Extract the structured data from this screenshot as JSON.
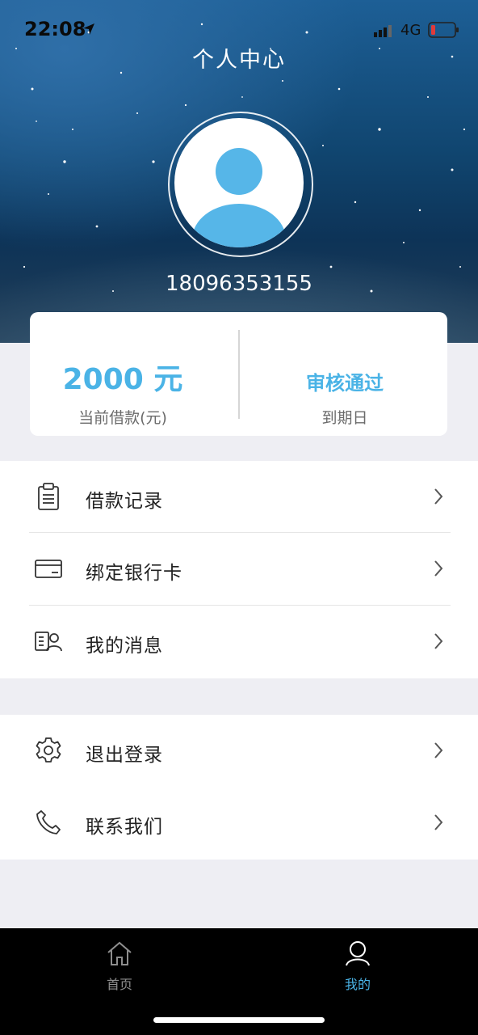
{
  "status_bar": {
    "time": "22:08",
    "network": "4G"
  },
  "header": {
    "title": "个人中心",
    "phone": "18096353155"
  },
  "summary": {
    "amount": "2000 元",
    "amount_label": "当前借款(元)",
    "status": "审核通过",
    "status_label": "到期日"
  },
  "menu_group_1": [
    {
      "label": "借款记录",
      "icon": "clipboard-icon"
    },
    {
      "label": "绑定银行卡",
      "icon": "card-icon"
    },
    {
      "label": "我的消息",
      "icon": "message-user-icon"
    }
  ],
  "menu_group_2": [
    {
      "label": "退出登录",
      "icon": "gear-icon"
    },
    {
      "label": "联系我们",
      "icon": "phone-icon"
    }
  ],
  "tabs": [
    {
      "label": "首页",
      "icon": "home-icon",
      "active": false
    },
    {
      "label": "我的",
      "icon": "user-icon",
      "active": true
    }
  ],
  "colors": {
    "accent": "#4ab3e6",
    "tab_active": "#4ab3e6",
    "tab_inactive": "#8e8e8e"
  }
}
